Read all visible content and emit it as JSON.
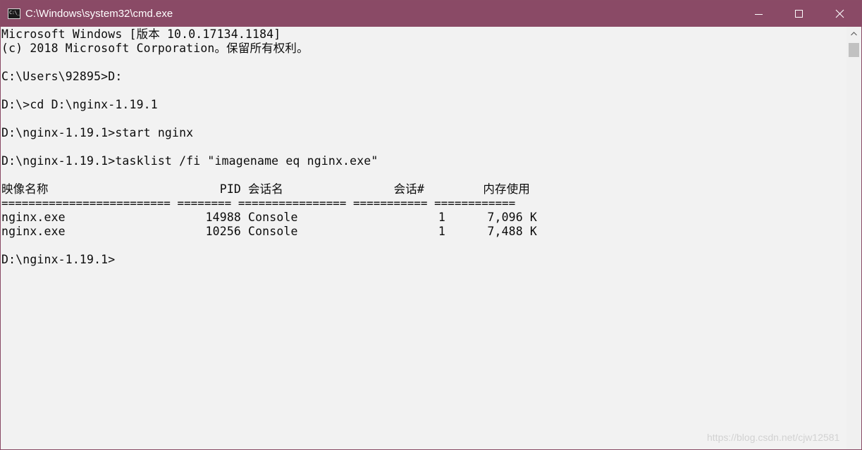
{
  "window": {
    "title": "C:\\Windows\\system32\\cmd.exe",
    "icon_label": "C:\\_",
    "icons": {
      "app": "command-prompt-icon",
      "minimize": "minimize-icon",
      "maximize": "maximize-icon",
      "close": "close-icon"
    },
    "titlebar_color": "#8a4a66"
  },
  "console": {
    "banner": [
      "Microsoft Windows [版本 10.0.17134.1184]",
      "(c) 2018 Microsoft Corporation。保留所有权利。"
    ],
    "commands": [
      "C:\\Users\\92895>D:",
      "D:\\>cd D:\\nginx-1.19.1",
      "D:\\nginx-1.19.1>start nginx",
      "D:\\nginx-1.19.1>tasklist /fi \"imagename eq nginx.exe\""
    ],
    "table": {
      "headers": [
        "映像名称",
        "PID",
        "会话名",
        "会话#",
        "内存使用"
      ],
      "separator": "========================= ======== ================ =========== ============",
      "rows": [
        [
          "nginx.exe",
          "14988",
          "Console",
          "1",
          "7,096 K"
        ],
        [
          "nginx.exe",
          "10256",
          "Console",
          "1",
          "7,488 K"
        ]
      ]
    },
    "prompt": "D:\\nginx-1.19.1>",
    "background_color": "#f2f2f2",
    "text_color": "#0c0c0c"
  },
  "watermark": "https://blog.csdn.net/cjw12581"
}
